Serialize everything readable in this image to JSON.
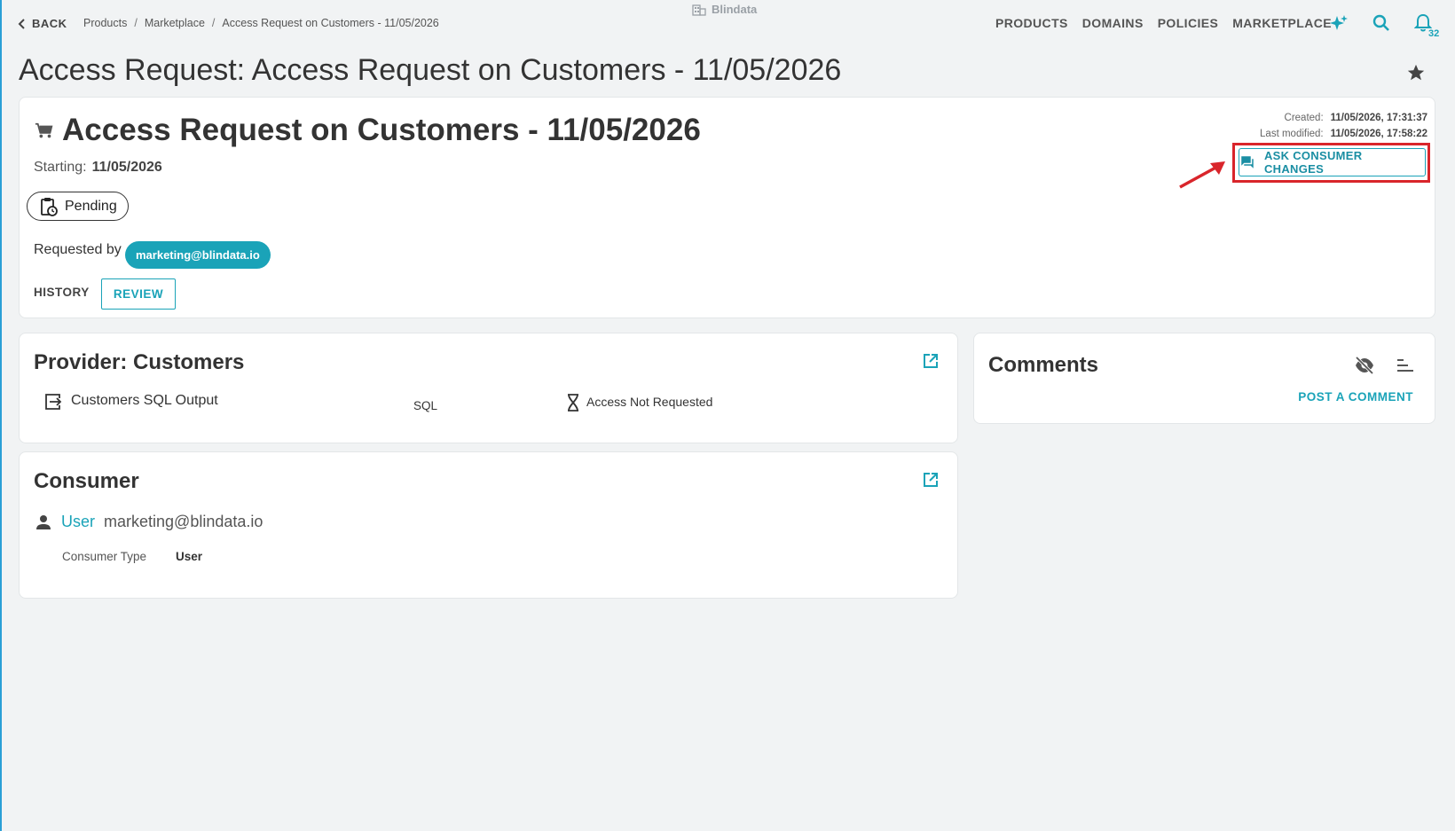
{
  "topbar": {
    "back_label": "BACK",
    "breadcrumb": [
      "Products",
      "Marketplace",
      "Access Request on Customers - 11/05/2026"
    ],
    "brand": "Blindata",
    "nav": [
      "PRODUCTS",
      "DOMAINS",
      "POLICIES",
      "MARKETPLACE"
    ],
    "notification_count": "32"
  },
  "page": {
    "title": "Access Request: Access Request on Customers - 11/05/2026"
  },
  "request": {
    "title": "Access Request on Customers - 11/05/2026",
    "starting_label": "Starting:",
    "starting_value": "11/05/2026",
    "created_label": "Created:",
    "created_value": "11/05/2026, 17:31:37",
    "modified_label": "Last modified:",
    "modified_value": "11/05/2026, 17:58:22",
    "ask_button": "ASK CONSUMER CHANGES",
    "status": "Pending",
    "requested_by_label": "Requested by",
    "requested_by": "marketing@blindata.io",
    "tabs": [
      "HISTORY",
      "REVIEW"
    ],
    "active_tab": "REVIEW"
  },
  "provider": {
    "title": "Provider: Customers",
    "port": {
      "name": "Customers SQL Output",
      "kind": "SQL",
      "status": "Access Not Requested"
    }
  },
  "consumer": {
    "title": "Consumer",
    "role": "User",
    "identity": "marketing@blindata.io",
    "type_label": "Consumer Type",
    "type_value": "User"
  },
  "comments": {
    "title": "Comments",
    "post_label": "POST A COMMENT"
  },
  "colors": {
    "accent": "#1aa3b8",
    "highlight": "#d9252b",
    "background": "#f1f3f4"
  },
  "icons": [
    "chevron-left-icon",
    "building-icon",
    "sparkles-icon",
    "search-icon",
    "bell-icon",
    "star-icon",
    "cart-icon",
    "chat-icon",
    "clipboard-clock-icon",
    "external-link-icon",
    "output-port-icon",
    "hourglass-icon",
    "person-icon",
    "eye-off-icon",
    "sort-icon"
  ]
}
